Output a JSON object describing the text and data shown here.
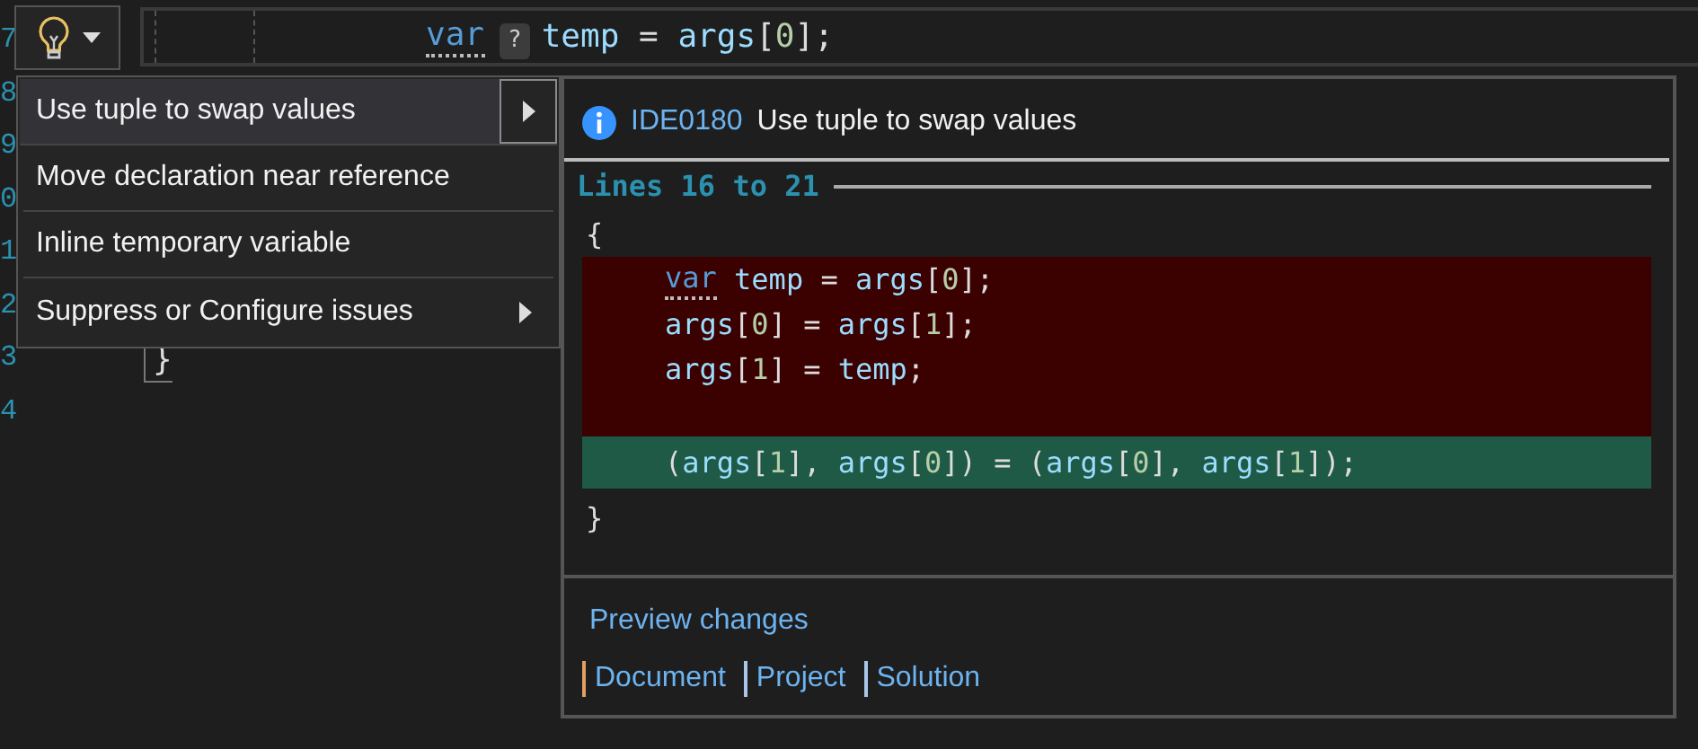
{
  "editor": {
    "line_numbers": [
      "7",
      "8",
      "9",
      "0",
      "1",
      "2",
      "3",
      "4"
    ],
    "current_line": [
      {
        "text": "var",
        "kind": "keyword",
        "hint": true
      },
      {
        "text": "?",
        "kind": "badge"
      },
      {
        "text": "temp",
        "kind": "identifier"
      },
      {
        "text": " = ",
        "kind": "punctuation"
      },
      {
        "text": "args",
        "kind": "identifier"
      },
      {
        "text": "[",
        "kind": "punctuation"
      },
      {
        "text": "0",
        "kind": "number"
      },
      {
        "text": "];",
        "kind": "punctuation"
      }
    ],
    "closing_brace": "}"
  },
  "lightbulb_menu": {
    "items": [
      {
        "label": "Use tuple to swap values",
        "has_submenu": true,
        "selected": true
      },
      {
        "label": "Move declaration near reference",
        "has_submenu": false,
        "selected": false
      },
      {
        "label": "Inline temporary variable",
        "has_submenu": false,
        "selected": false
      },
      {
        "label": "Suppress or Configure issues",
        "has_submenu": true,
        "selected": false
      }
    ]
  },
  "preview": {
    "diagnostic_id": "IDE0180",
    "title": "Use tuple to swap values",
    "range": "Lines 16 to 21",
    "lines": [
      {
        "kind": "context",
        "tokens": [
          {
            "text": "{",
            "kind": "punctuation"
          }
        ]
      },
      {
        "kind": "removed",
        "tokens": [
          {
            "text": "var",
            "kind": "keyword",
            "hint": true
          },
          {
            "text": " temp",
            "kind": "identifier"
          },
          {
            "text": " = ",
            "kind": "punctuation"
          },
          {
            "text": "args",
            "kind": "identifier"
          },
          {
            "text": "[",
            "kind": "punctuation"
          },
          {
            "text": "0",
            "kind": "number"
          },
          {
            "text": "];",
            "kind": "punctuation"
          }
        ]
      },
      {
        "kind": "removed",
        "tokens": [
          {
            "text": "args",
            "kind": "identifier"
          },
          {
            "text": "[",
            "kind": "punctuation"
          },
          {
            "text": "0",
            "kind": "number"
          },
          {
            "text": "] = ",
            "kind": "punctuation"
          },
          {
            "text": "args",
            "kind": "identifier"
          },
          {
            "text": "[",
            "kind": "punctuation"
          },
          {
            "text": "1",
            "kind": "number"
          },
          {
            "text": "];",
            "kind": "punctuation"
          }
        ]
      },
      {
        "kind": "removed",
        "tokens": [
          {
            "text": "args",
            "kind": "identifier"
          },
          {
            "text": "[",
            "kind": "punctuation"
          },
          {
            "text": "1",
            "kind": "number"
          },
          {
            "text": "] = ",
            "kind": "punctuation"
          },
          {
            "text": "temp",
            "kind": "identifier"
          },
          {
            "text": ";",
            "kind": "punctuation"
          }
        ]
      },
      {
        "kind": "removed"
      },
      {
        "kind": "added",
        "tokens": [
          {
            "text": "(",
            "kind": "punctuation"
          },
          {
            "text": "args",
            "kind": "identifier"
          },
          {
            "text": "[",
            "kind": "punctuation"
          },
          {
            "text": "1",
            "kind": "number"
          },
          {
            "text": "], ",
            "kind": "punctuation"
          },
          {
            "text": "args",
            "kind": "identifier"
          },
          {
            "text": "[",
            "kind": "punctuation"
          },
          {
            "text": "0",
            "kind": "number"
          },
          {
            "text": "]) = (",
            "kind": "punctuation"
          },
          {
            "text": "args",
            "kind": "identifier"
          },
          {
            "text": "[",
            "kind": "punctuation"
          },
          {
            "text": "0",
            "kind": "number"
          },
          {
            "text": "], ",
            "kind": "punctuation"
          },
          {
            "text": "args",
            "kind": "identifier"
          },
          {
            "text": "[",
            "kind": "punctuation"
          },
          {
            "text": "1",
            "kind": "number"
          },
          {
            "text": "]);",
            "kind": "punctuation"
          }
        ]
      },
      {
        "kind": "context",
        "tokens": [
          {
            "text": "}",
            "kind": "punctuation"
          }
        ]
      }
    ],
    "preview_link": "Preview changes",
    "scopes": [
      "Document",
      "Project",
      "Solution"
    ]
  }
}
